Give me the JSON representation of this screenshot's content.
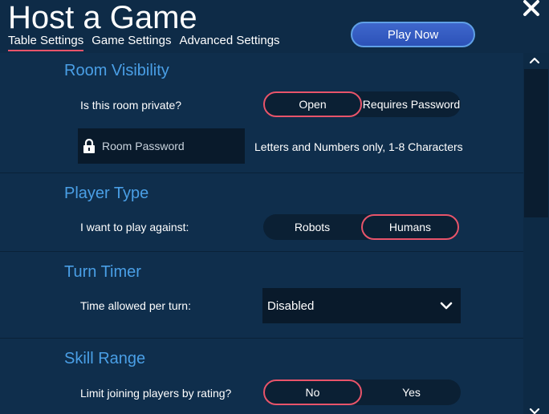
{
  "header": {
    "title": "Host a Game",
    "tabs": [
      "Table Settings",
      "Game Settings",
      "Advanced Settings"
    ],
    "active_tab": "Table Settings",
    "play_button": "Play Now",
    "close_icon": "close-icon"
  },
  "sections": {
    "room_visibility": {
      "title": "Room Visibility",
      "question": "Is this room private?",
      "options": [
        "Open",
        "Requires Password"
      ],
      "selected": "Open",
      "password_placeholder": "Room Password",
      "password_hint": "Letters and Numbers only, 1-8 Characters",
      "lock_icon": "lock-icon"
    },
    "player_type": {
      "title": "Player Type",
      "question": "I want to play against:",
      "options": [
        "Robots",
        "Humans"
      ],
      "selected": "Humans"
    },
    "turn_timer": {
      "title": "Turn Timer",
      "question": "Time allowed per turn:",
      "value": "Disabled"
    },
    "skill_range": {
      "title": "Skill Range",
      "question": "Limit joining players by rating?",
      "options": [
        "No",
        "Yes"
      ],
      "selected": "No"
    }
  },
  "colors": {
    "accent": "#4a9fe6",
    "selected_border": "#e8546a",
    "background": "#0f2e4c",
    "play_button": "#3f67cc"
  }
}
